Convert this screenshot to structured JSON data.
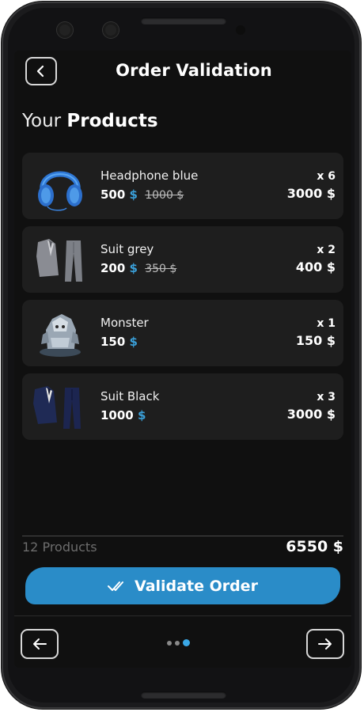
{
  "header": {
    "title": "Order Validation"
  },
  "section": {
    "title_light": "Your",
    "title_bold": "Products"
  },
  "products": [
    {
      "name": "Headphone blue",
      "price": "500",
      "currency": "$",
      "old_price": "1000 $",
      "qty": "x 6",
      "total": "3000 $",
      "icon": "headphones-image"
    },
    {
      "name": "Suit grey",
      "price": "200",
      "currency": "$",
      "old_price": "350 $",
      "qty": "x 2",
      "total": "400 $",
      "icon": "grey-suit-image"
    },
    {
      "name": "Monster",
      "price": "150",
      "currency": "$",
      "old_price": "",
      "qty": "x 1",
      "total": "150 $",
      "icon": "monster-figure-image"
    },
    {
      "name": "Suit Black",
      "price": "1000",
      "currency": "$",
      "old_price": "",
      "qty": "x 3",
      "total": "3000 $",
      "icon": "black-suit-image"
    }
  ],
  "summary": {
    "count_label": "12 Products",
    "total": "6550 $"
  },
  "actions": {
    "validate_label": "Validate Order"
  },
  "pager": {
    "pages": 3,
    "active": 2
  },
  "colors": {
    "accent": "#2a8cc8",
    "currency": "#3a9fd8",
    "background": "#101010",
    "card": "#1e1e1e"
  }
}
